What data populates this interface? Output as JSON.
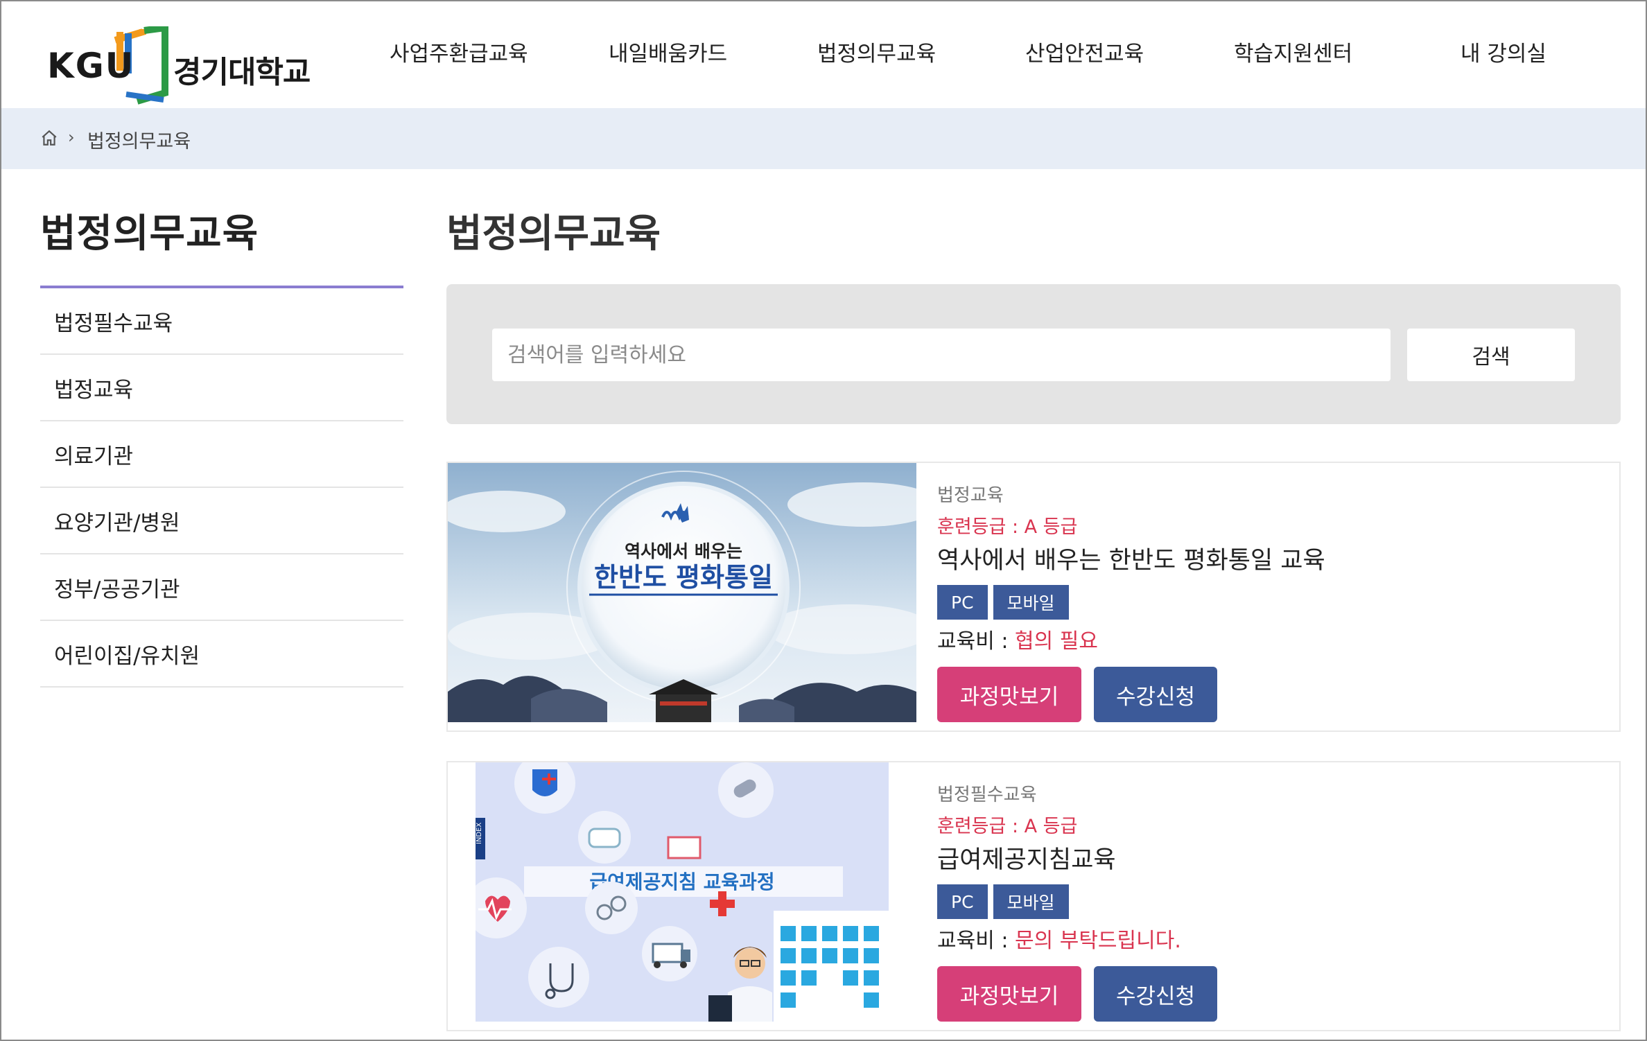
{
  "header": {
    "logo_abbr": "KGU",
    "logo_name": "경기대학교",
    "nav": [
      "사업주환급교육",
      "내일배움카드",
      "법정의무교육",
      "산업안전교육",
      "학습지원센터",
      "내 강의실"
    ]
  },
  "breadcrumb": {
    "home_icon": "home-icon",
    "current": "법정의무교육"
  },
  "sidebar": {
    "title": "법정의무교육",
    "items": [
      "법정필수교육",
      "법정교육",
      "의료기관",
      "요양기관/병원",
      "정부/공공기관",
      "어린이집/유치원"
    ]
  },
  "main": {
    "title": "법정의무교육"
  },
  "search": {
    "placeholder": "검색어를 입력하세요",
    "button": "검색"
  },
  "courses": [
    {
      "category": "법정교육",
      "grade": "훈련등급 : A 등급",
      "title": "역사에서 배우는 한반도 평화통일 교육",
      "tags": [
        "PC",
        "모바일"
      ],
      "fee_label": "교육비 : ",
      "fee_value": "협의 필요",
      "preview_label": "과정맛보기",
      "apply_label": "수강신청",
      "thumb_line1": "역사에서 배우는",
      "thumb_line2": "한반도 평화통일"
    },
    {
      "category": "법정필수교육",
      "grade": "훈련등급 : A 등급",
      "title": "급여제공지침교육",
      "tags": [
        "PC",
        "모바일"
      ],
      "fee_label": "교육비 : ",
      "fee_value": "문의 부탁드립니다.",
      "preview_label": "과정맛보기",
      "apply_label": "수강신청",
      "thumb_line1": "급여제공지침 교육과정",
      "thumb_tab": "INDEX"
    }
  ],
  "colors": {
    "accent_red": "#d9344f",
    "tag_blue": "#3c5a99",
    "preview_pink": "#d63f78",
    "breadcrumb_bg": "#e7edf6",
    "sidebar_line": "#8a7dd0"
  }
}
